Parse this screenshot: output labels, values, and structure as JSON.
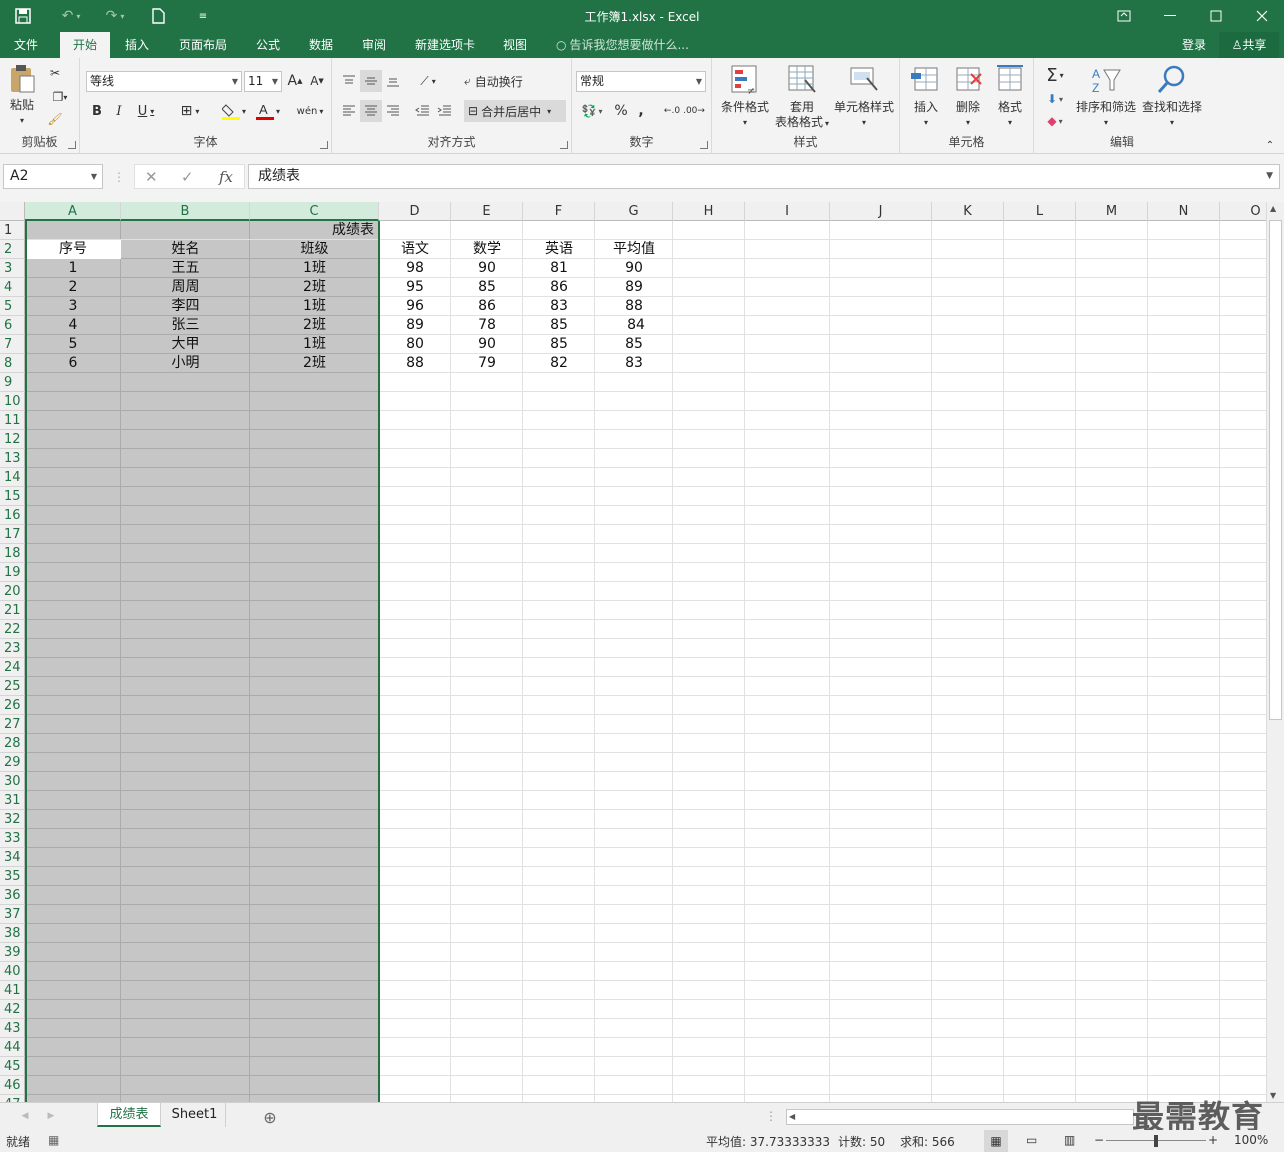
{
  "window": {
    "title": "工作簿1.xlsx - Excel"
  },
  "ribbon_tabs": [
    {
      "label": "文件"
    },
    {
      "label": "开始"
    },
    {
      "label": "插入"
    },
    {
      "label": "页面布局"
    },
    {
      "label": "公式"
    },
    {
      "label": "数据"
    },
    {
      "label": "审阅"
    },
    {
      "label": "新建选项卡"
    },
    {
      "label": "视图"
    }
  ],
  "tell_me": "告诉我您想要做什么...",
  "login": "登录",
  "share": "共享",
  "ribbon": {
    "clipboard": {
      "paste": "粘贴",
      "label": "剪贴板"
    },
    "font": {
      "name": "等线",
      "size": "11",
      "label": "字体"
    },
    "alignment": {
      "wrap": "自动换行",
      "merge": "合并后居中",
      "label": "对齐方式"
    },
    "number": {
      "format": "常规",
      "label": "数字"
    },
    "styles": {
      "conditional": "条件格式",
      "table1": "套用",
      "table2": "表格格式",
      "cell_styles": "单元格样式",
      "label": "样式"
    },
    "cells": {
      "insert": "插入",
      "delete": "删除",
      "format": "格式",
      "label": "单元格"
    },
    "editing": {
      "sort": "排序和筛选",
      "find": "查找和选择",
      "label": "编辑"
    }
  },
  "formula_bar": {
    "name_box": "A2",
    "formula": "成绩表"
  },
  "columns": [
    "A",
    "B",
    "C",
    "D",
    "E",
    "F",
    "G",
    "H",
    "I",
    "J",
    "K",
    "L",
    "M",
    "N",
    "O"
  ],
  "sheet": {
    "title_cell": "成绩表",
    "headers": [
      "序号",
      "姓名",
      "班级",
      "语文",
      "数学",
      "英语",
      "平均值"
    ],
    "rows": [
      [
        "1",
        "王五",
        "1班",
        "98",
        "90",
        "81",
        "90"
      ],
      [
        "2",
        "周周",
        "2班",
        "95",
        "85",
        "86",
        "89"
      ],
      [
        "3",
        "李四",
        "1班",
        "96",
        "86",
        "83",
        "88"
      ],
      [
        "4",
        "张三",
        "2班",
        "89",
        "78",
        "85",
        "84"
      ],
      [
        "5",
        "大甲",
        "1班",
        "80",
        "90",
        "85",
        "85"
      ],
      [
        "6",
        "小明",
        "2班",
        "88",
        "79",
        "82",
        "83"
      ]
    ]
  },
  "sheet_tabs": [
    "成绩表",
    "Sheet1"
  ],
  "status": {
    "ready": "就绪",
    "average": "平均值: 37.73333333",
    "count": "计数: 50",
    "sum": "求和: 566",
    "zoom": "100%"
  },
  "watermark": "最需教育",
  "colors": {
    "brand": "#217346",
    "selection_fill": "#c6c6c6"
  }
}
